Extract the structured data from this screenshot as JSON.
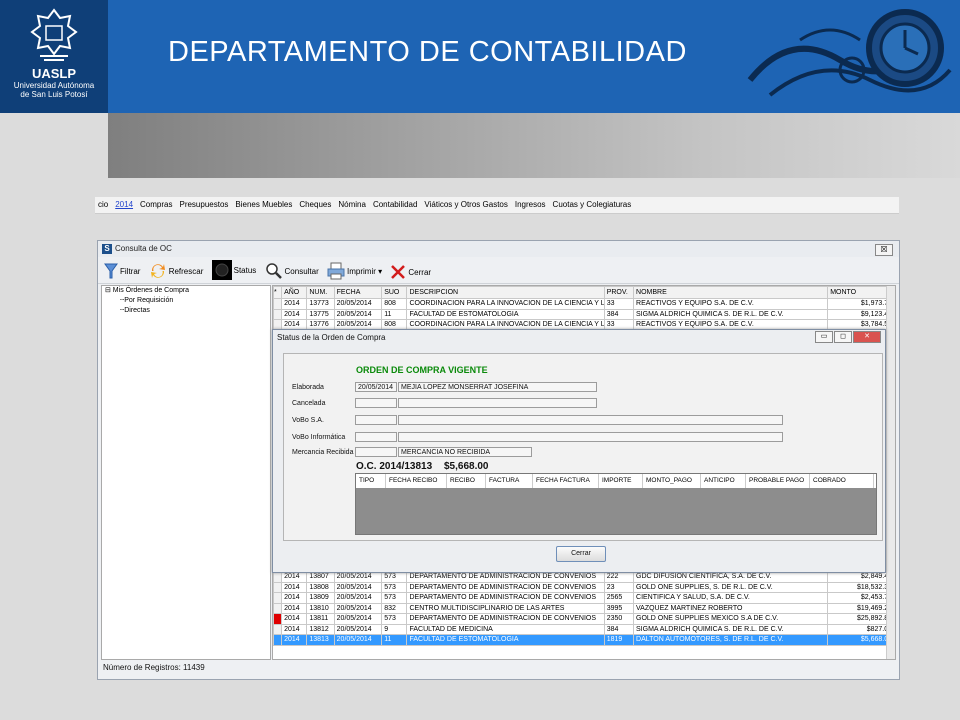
{
  "header": {
    "logo_name": "UASLP",
    "logo_sub_1": "Universidad Autónoma",
    "logo_sub_2": "de San Luis Potosí",
    "title": "DEPARTAMENTO DE CONTABILIDAD"
  },
  "menu": {
    "items": [
      "cio",
      "2014",
      "Compras",
      "Presupuestos",
      "Bienes Muebles",
      "Cheques",
      "Nómina",
      "Contabilidad",
      "Viáticos y Otros Gastos",
      "Ingresos",
      "Cuotas y Colegiaturas"
    ]
  },
  "window": {
    "title": "Consulta de OC",
    "close": "☒",
    "toolbar": {
      "filtrar": "Filtrar",
      "refrescar": "Refrescar",
      "status": "Status",
      "consultar": "Consultar",
      "imprimir": "Imprimir",
      "imprimir_caret": "▾",
      "cerrar": "Cerrar"
    },
    "tree": {
      "root": "⊟ Mis Órdenes de Compra",
      "child1": "Por Requisición",
      "child2": "Directas"
    },
    "grid": {
      "header_marker": "*",
      "columns": [
        "AÑO",
        "NUM.",
        "FECHA",
        "SUO",
        "DESCRIPCION",
        "PROV.",
        "NOMBRE",
        "MONTO"
      ],
      "top_rows": [
        {
          "anio": "2014",
          "num": "13773",
          "fecha": "20/05/2014",
          "suo": "808",
          "desc": "COORDINACION PARA LA INNOVACION DE LA CIENCIA Y LA...",
          "prov": "33",
          "nombre": "REACTIVOS Y EQUIPO S.A. DE C.V.",
          "monto": "$1,973.75"
        },
        {
          "anio": "2014",
          "num": "13775",
          "fecha": "20/05/2014",
          "suo": "11",
          "desc": "FACULTAD DE ESTOMATOLOGIA",
          "prov": "384",
          "nombre": "SIGMA ALDRICH QUIMICA S. DE R.L. DE C.V.",
          "monto": "$9,123.40"
        },
        {
          "anio": "2014",
          "num": "13776",
          "fecha": "20/05/2014",
          "suo": "808",
          "desc": "COORDINACION PARA LA INNOVACION DE LA CIENCIA Y LA...",
          "prov": "33",
          "nombre": "REACTIVOS Y EQUIPO S.A. DE C.V.",
          "monto": "$3,784.50"
        }
      ],
      "bottom_rows": [
        {
          "anio": "2014",
          "num": "13806",
          "fecha": "20/05/2014",
          "suo": "573",
          "desc": "DEPARTAMENTO DE ADMINISTRACION DE CONVENIOS",
          "prov": "33",
          "nombre": "REACTIVOS Y EQUIPO S.A. DE C.V.",
          "monto": "$2,341.32"
        },
        {
          "anio": "2014",
          "num": "13807",
          "fecha": "20/05/2014",
          "suo": "573",
          "desc": "DEPARTAMENTO DE ADMINISTRACION DE CONVENIOS",
          "prov": "222",
          "nombre": "GDC DIFUSION CIENTIFICA, S.A. DE C.V.",
          "monto": "$2,849.43"
        },
        {
          "anio": "2014",
          "num": "13808",
          "fecha": "20/05/2014",
          "suo": "573",
          "desc": "DEPARTAMENTO DE ADMINISTRACION DE CONVENIOS",
          "prov": "23",
          "nombre": "GOLD ONE SUPPLIES, S. DE R.L. DE C.V.",
          "monto": "$18,532.35"
        },
        {
          "anio": "2014",
          "num": "13809",
          "fecha": "20/05/2014",
          "suo": "573",
          "desc": "DEPARTAMENTO DE ADMINISTRACION DE CONVENIOS",
          "prov": "2565",
          "nombre": "CIENTIFICA Y SALUD, S.A. DE C.V.",
          "monto": "$2,453.74"
        },
        {
          "anio": "2014",
          "num": "13810",
          "fecha": "20/05/2014",
          "suo": "832",
          "desc": "CENTRO MULTIDISCIPLINARIO DE LAS ARTES",
          "prov": "3995",
          "nombre": "VAZQUEZ MARTINEZ ROBERTO",
          "monto": "$19,469.21"
        },
        {
          "anio": "2014",
          "num": "13811",
          "fecha": "20/05/2014",
          "suo": "573",
          "desc": "DEPARTAMENTO DE ADMINISTRACION DE CONVENIOS",
          "prov": "2350",
          "nombre": "GOLD ONE SUPPLIES MEXICO S.A DE C.V.",
          "monto": "$25,892.80"
        },
        {
          "anio": "2014",
          "num": "13812",
          "fecha": "20/05/2014",
          "suo": "9",
          "desc": "FACULTAD DE MEDICINA",
          "prov": "384",
          "nombre": "SIGMA ALDRICH QUIMICA S. DE R.L. DE C.V.",
          "monto": "$827.08"
        },
        {
          "anio": "2014",
          "num": "13813",
          "fecha": "20/05/2014",
          "suo": "11",
          "desc": "FACULTAD DE ESTOMATOLOGIA",
          "prov": "1819",
          "nombre": "DALTON AUTOMOTORES, S. DE R.L. DE C.V.",
          "monto": "$5,668.00"
        }
      ],
      "flagged_row_num": "13811",
      "selected_row_num": "13813"
    },
    "records_label": "Número de Registros: 11439"
  },
  "dialog": {
    "title": "Status de la Orden de Compra",
    "status": "ORDEN DE COMPRA VIGENTE",
    "fields": {
      "elaborada_label": "Elaborada",
      "elaborada_date": "20/05/2014",
      "elaborada_person": "MEJIA LOPEZ MONSERRAT JOSEFINA",
      "cancelada_label": "Cancelada",
      "vobo_sa_label": "VoBo S.A.",
      "vobo_inf_label": "VoBo Informática",
      "mercancia_label": "Mercancia Recibida",
      "mercancia_value": "MERCANCIA NO RECIBIDA"
    },
    "oc_number": "O.C. 2014/13813",
    "oc_amount": "$5,668.00",
    "columns": [
      "TIPO",
      "FECHA RECIBO",
      "RECIBO",
      "FACTURA",
      "FECHA FACTURA",
      "IMPORTE",
      "MONTO_PAGO",
      "ANTICIPO",
      "PROBABLE PAGO",
      "COBRADO"
    ],
    "close_button": "Cerrar",
    "win_btn_min": "▭",
    "win_btn_max": "◻",
    "win_btn_close": "✕"
  },
  "colors": {
    "banner": "#1e64b4",
    "logo_bg": "#0f3f78",
    "status_green": "#0a8a0a",
    "selection": "#3399ff"
  }
}
